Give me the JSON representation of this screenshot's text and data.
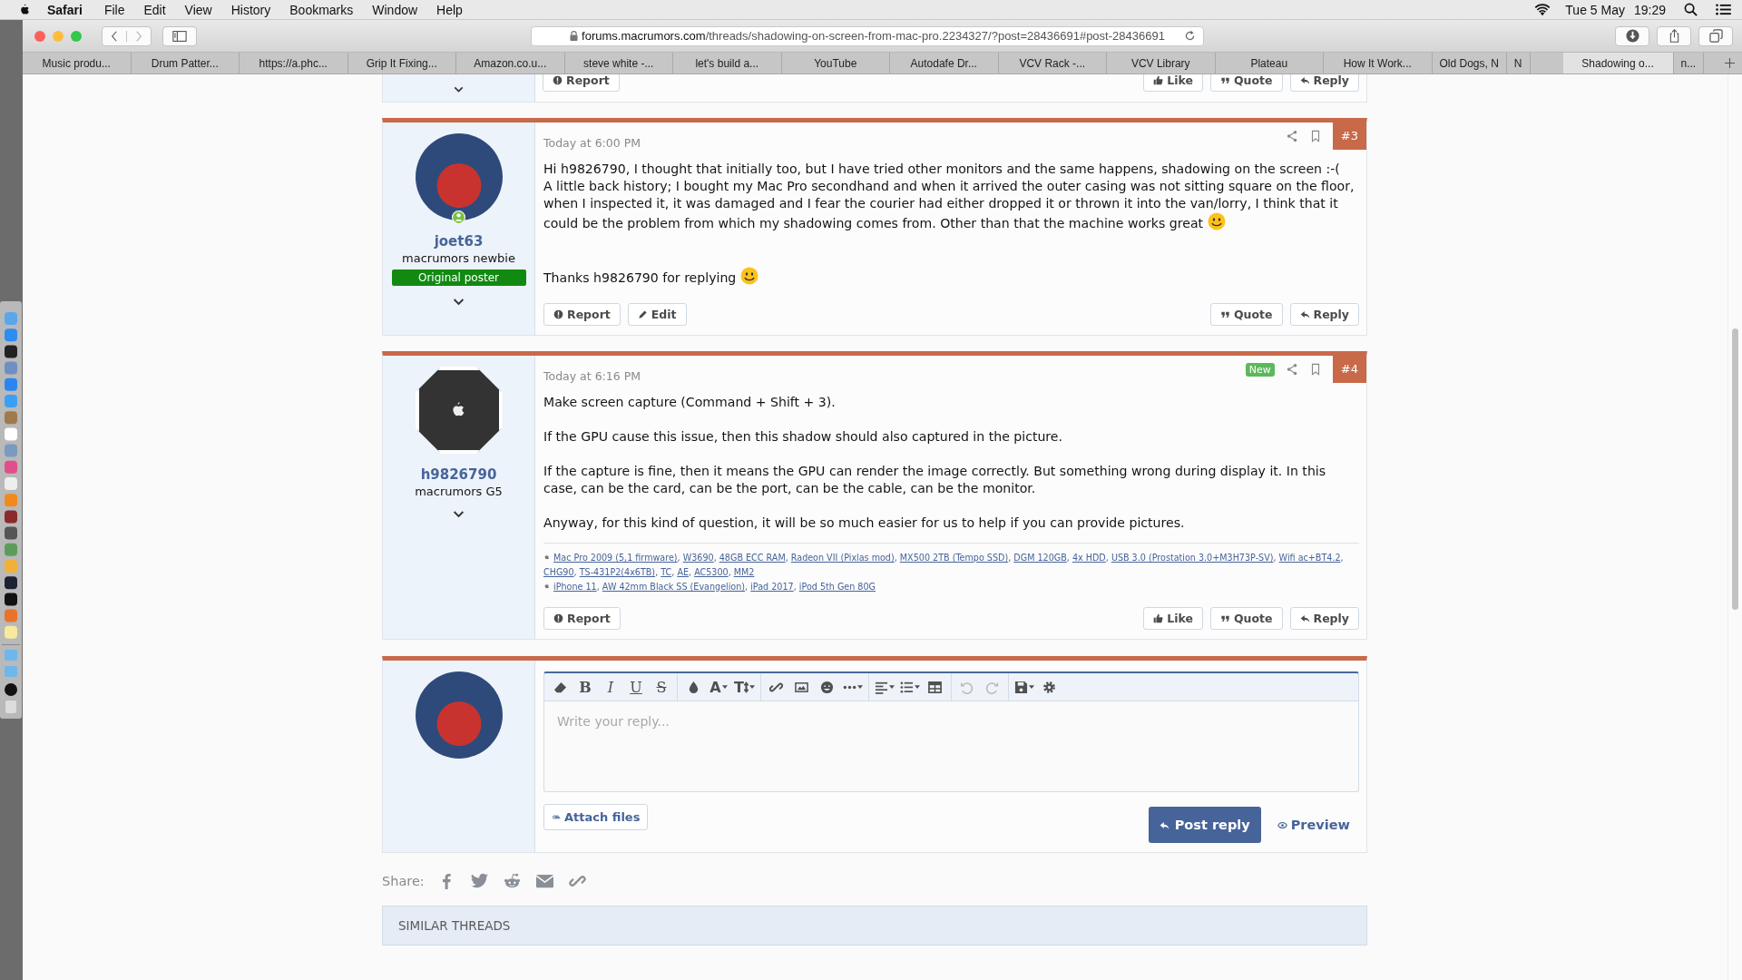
{
  "menubar": {
    "app": "Safari",
    "items": [
      "File",
      "Edit",
      "View",
      "History",
      "Bookmarks",
      "Window",
      "Help"
    ],
    "date": "Tue 5 May",
    "time": "19:29"
  },
  "browser": {
    "url_host": "forums.macrumors.com",
    "url_path": "/threads/shadowing-on-screen-from-mac-pro.2234327/?post=28436691#post-28436691",
    "tabs": [
      {
        "label": "Music produ...",
        "selected": false
      },
      {
        "label": "Drum Patter...",
        "selected": false
      },
      {
        "label": "https://a.phc...",
        "selected": false
      },
      {
        "label": "Grip It Fixing...",
        "selected": false
      },
      {
        "label": "Amazon.co.u...",
        "selected": false
      },
      {
        "label": "steve white -...",
        "selected": false
      },
      {
        "label": "let's build a...",
        "selected": false
      },
      {
        "label": "YouTube",
        "selected": false
      },
      {
        "label": "Autodafe Dr...",
        "selected": false
      },
      {
        "label": "VCV Rack -...",
        "selected": false
      },
      {
        "label": "VCV Library",
        "selected": false
      },
      {
        "label": "Plateau",
        "selected": false
      },
      {
        "label": "How It Work...",
        "selected": false
      },
      {
        "label": "Old Dogs, N",
        "selected": false
      },
      {
        "label": "N",
        "selected": false
      },
      {
        "label": "Shadowing o...",
        "selected": true
      },
      {
        "label": "n...",
        "selected": false
      }
    ]
  },
  "posts": [
    {
      "kind": "partial",
      "actions_left": [
        {
          "kind": "report",
          "label": "Report"
        }
      ],
      "actions_right": [
        {
          "kind": "like",
          "label": "Like"
        },
        {
          "kind": "quote",
          "label": "Quote"
        },
        {
          "kind": "reply",
          "label": "Reply"
        }
      ]
    },
    {
      "kind": "post",
      "author": {
        "name": "joet63",
        "title": "macrumors newbie",
        "badge": "Original poster",
        "online": true,
        "avatar": {
          "kind": "photo"
        }
      },
      "time": "Today at 6:00 PM",
      "number": "#3",
      "blocks": [
        {
          "text": "Hi h9826790, I thought that initially too, but I have tried other monitors and the same happens, shadowing on the screen :-(\nA little back history; I bought my Mac Pro secondhand and when it arrived the outer casing was not sitting square on the floor, when I inspected it, it was damaged and I fear the courier had either dropped it or thrown it into the van/lorry, I think that it could be the problem from which my shadowing comes from. Other than that the machine works great",
          "smiley": true
        },
        {
          "text": "Thanks h9826790 for replying",
          "smiley": true
        }
      ],
      "actions_left": [
        {
          "kind": "report",
          "label": "Report"
        },
        {
          "kind": "edit",
          "label": "Edit"
        }
      ],
      "actions_right": [
        {
          "kind": "quote",
          "label": "Quote"
        },
        {
          "kind": "reply",
          "label": "Reply"
        }
      ]
    },
    {
      "kind": "post",
      "author": {
        "name": "h9826790",
        "title": "macrumors G5",
        "online": false,
        "avatar": {
          "kind": "logo"
        }
      },
      "time": "Today at 6:16 PM",
      "new_badge": "New",
      "number": "#4",
      "blocks": [
        {
          "text": "Make screen capture (Command + Shift + 3).",
          "smiley": false
        },
        {
          "text": "If the GPU cause this issue, then this shadow should also captured in the picture.",
          "smiley": false
        },
        {
          "text": "If the capture is fine, then it means the GPU can render the image correctly. But something wrong during display it. In this case, can be the card, can be the port, can be the cable, can be the monitor.",
          "smiley": false
        },
        {
          "text": "Anyway, for this kind of question, it will be so much easier for us to help if you can provide pictures.",
          "smiley": false
        }
      ],
      "signature": [
        [
          {
            "text": "Mac Pro 2009 (5,1 firmware)",
            "sep": ","
          },
          {
            "text": "W3690",
            "sep": ","
          },
          {
            "text": "48GB ECC RAM",
            "sep": ","
          },
          {
            "text": "Radeon VII (Pixlas mod)",
            "sep": ","
          },
          {
            "text": "MX500 2TB (Tempo SSD)",
            "sep": ","
          },
          {
            "text": "DGM 120GB",
            "sep": ","
          },
          {
            "text": "4x HDD",
            "sep": ","
          },
          {
            "text": "USB 3.0 (Prostation 3.0+M3H73P-SV)",
            "sep": ","
          },
          {
            "text": "Wifi ac+BT4.2",
            "sep": ","
          },
          {
            "text": "CHG90",
            "sep": ","
          },
          {
            "text": "TS-431P2(4x6TB)",
            "sep": ","
          },
          {
            "text": "TC",
            "sep": ","
          },
          {
            "text": "AE",
            "sep": ","
          },
          {
            "text": "AC5300",
            "sep": ","
          },
          {
            "text": "MM2"
          }
        ],
        [
          {
            "text": "iPhone 11",
            "sep": ","
          },
          {
            "text": "AW 42mm Black SS (Evangelion)",
            "sep": ","
          },
          {
            "text": "iPad 2017",
            "sep": ","
          },
          {
            "text": "iPod 5th Gen 80G"
          }
        ]
      ],
      "actions_left": [
        {
          "kind": "report",
          "label": "Report"
        }
      ],
      "actions_right": [
        {
          "kind": "like",
          "label": "Like"
        },
        {
          "kind": "quote",
          "label": "Quote"
        },
        {
          "kind": "reply",
          "label": "Reply"
        }
      ]
    }
  ],
  "editor": {
    "avatar": {
      "kind": "photo"
    },
    "placeholder": "Write your reply...",
    "toolbar": [
      [
        {
          "kind": "eraser",
          "caret": false,
          "disabled": false
        },
        {
          "kind": "bold",
          "glyph": "B",
          "caret": false,
          "disabled": false
        },
        {
          "kind": "italic",
          "glyph": "I",
          "caret": false,
          "disabled": false
        },
        {
          "kind": "underline",
          "glyph": "U",
          "caret": false,
          "disabled": false
        },
        {
          "kind": "strike",
          "glyph": "S",
          "caret": false,
          "disabled": false
        }
      ],
      [
        {
          "kind": "color",
          "caret": false,
          "disabled": false
        },
        {
          "kind": "font",
          "glyph": "A",
          "caret": true,
          "disabled": false
        },
        {
          "kind": "size",
          "glyph": "T",
          "caret": true,
          "disabled": false
        }
      ],
      [
        {
          "kind": "link",
          "caret": false,
          "disabled": false
        },
        {
          "kind": "image",
          "caret": false,
          "disabled": false
        },
        {
          "kind": "smiley",
          "caret": false,
          "disabled": false
        },
        {
          "kind": "more",
          "caret": true,
          "disabled": false
        }
      ],
      [
        {
          "kind": "align",
          "caret": true,
          "disabled": false
        },
        {
          "kind": "list",
          "caret": true,
          "disabled": false
        },
        {
          "kind": "table",
          "caret": false,
          "disabled": false
        }
      ],
      [
        {
          "kind": "undo",
          "caret": false,
          "disabled": true
        },
        {
          "kind": "redo",
          "caret": false,
          "disabled": true
        }
      ],
      [
        {
          "kind": "save",
          "caret": true,
          "disabled": false
        },
        {
          "kind": "gear",
          "caret": false,
          "disabled": false
        }
      ]
    ],
    "attach_label": "Attach files",
    "submit_label": "Post reply",
    "preview_label": "Preview"
  },
  "share": {
    "label": "Share:"
  },
  "similar_threads": {
    "title": "SIMILAR THREADS"
  }
}
